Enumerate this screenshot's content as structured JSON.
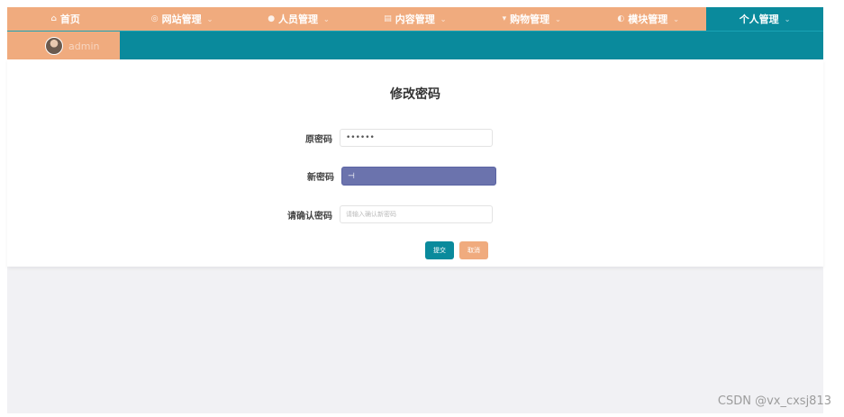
{
  "nav": {
    "items": [
      {
        "label": "首页",
        "icon": "home-icon",
        "glyph": "⌂",
        "caret": ""
      },
      {
        "label": "网站管理",
        "icon": "globe-icon",
        "glyph": "◎",
        "caret": "⌄"
      },
      {
        "label": "人员管理",
        "icon": "user-icon",
        "glyph": "●",
        "caret": "⌄"
      },
      {
        "label": "内容管理",
        "icon": "document-icon",
        "glyph": "▤",
        "caret": "⌄"
      },
      {
        "label": "购物管理",
        "icon": "cart-icon",
        "glyph": "▾",
        "caret": "⌄"
      },
      {
        "label": "模块管理",
        "icon": "module-icon",
        "glyph": "◐",
        "caret": "⌄"
      },
      {
        "label": "个人管理",
        "icon": "",
        "glyph": "",
        "caret": "⌄"
      }
    ],
    "active_index": 6,
    "colors": {
      "primary": "#f0ab7e",
      "accent": "#0a8a9c"
    }
  },
  "user": {
    "name": "admin"
  },
  "form": {
    "title": "修改密码",
    "old_password": {
      "label": "原密码",
      "value": "••••••"
    },
    "new_password": {
      "label": "新密码",
      "value": "⊣"
    },
    "confirm_password": {
      "label": "请确认密码",
      "placeholder": "请输入确认新密码"
    },
    "submit_label": "提交",
    "cancel_label": "取消"
  },
  "watermark": "CSDN @vx_cxsj813"
}
